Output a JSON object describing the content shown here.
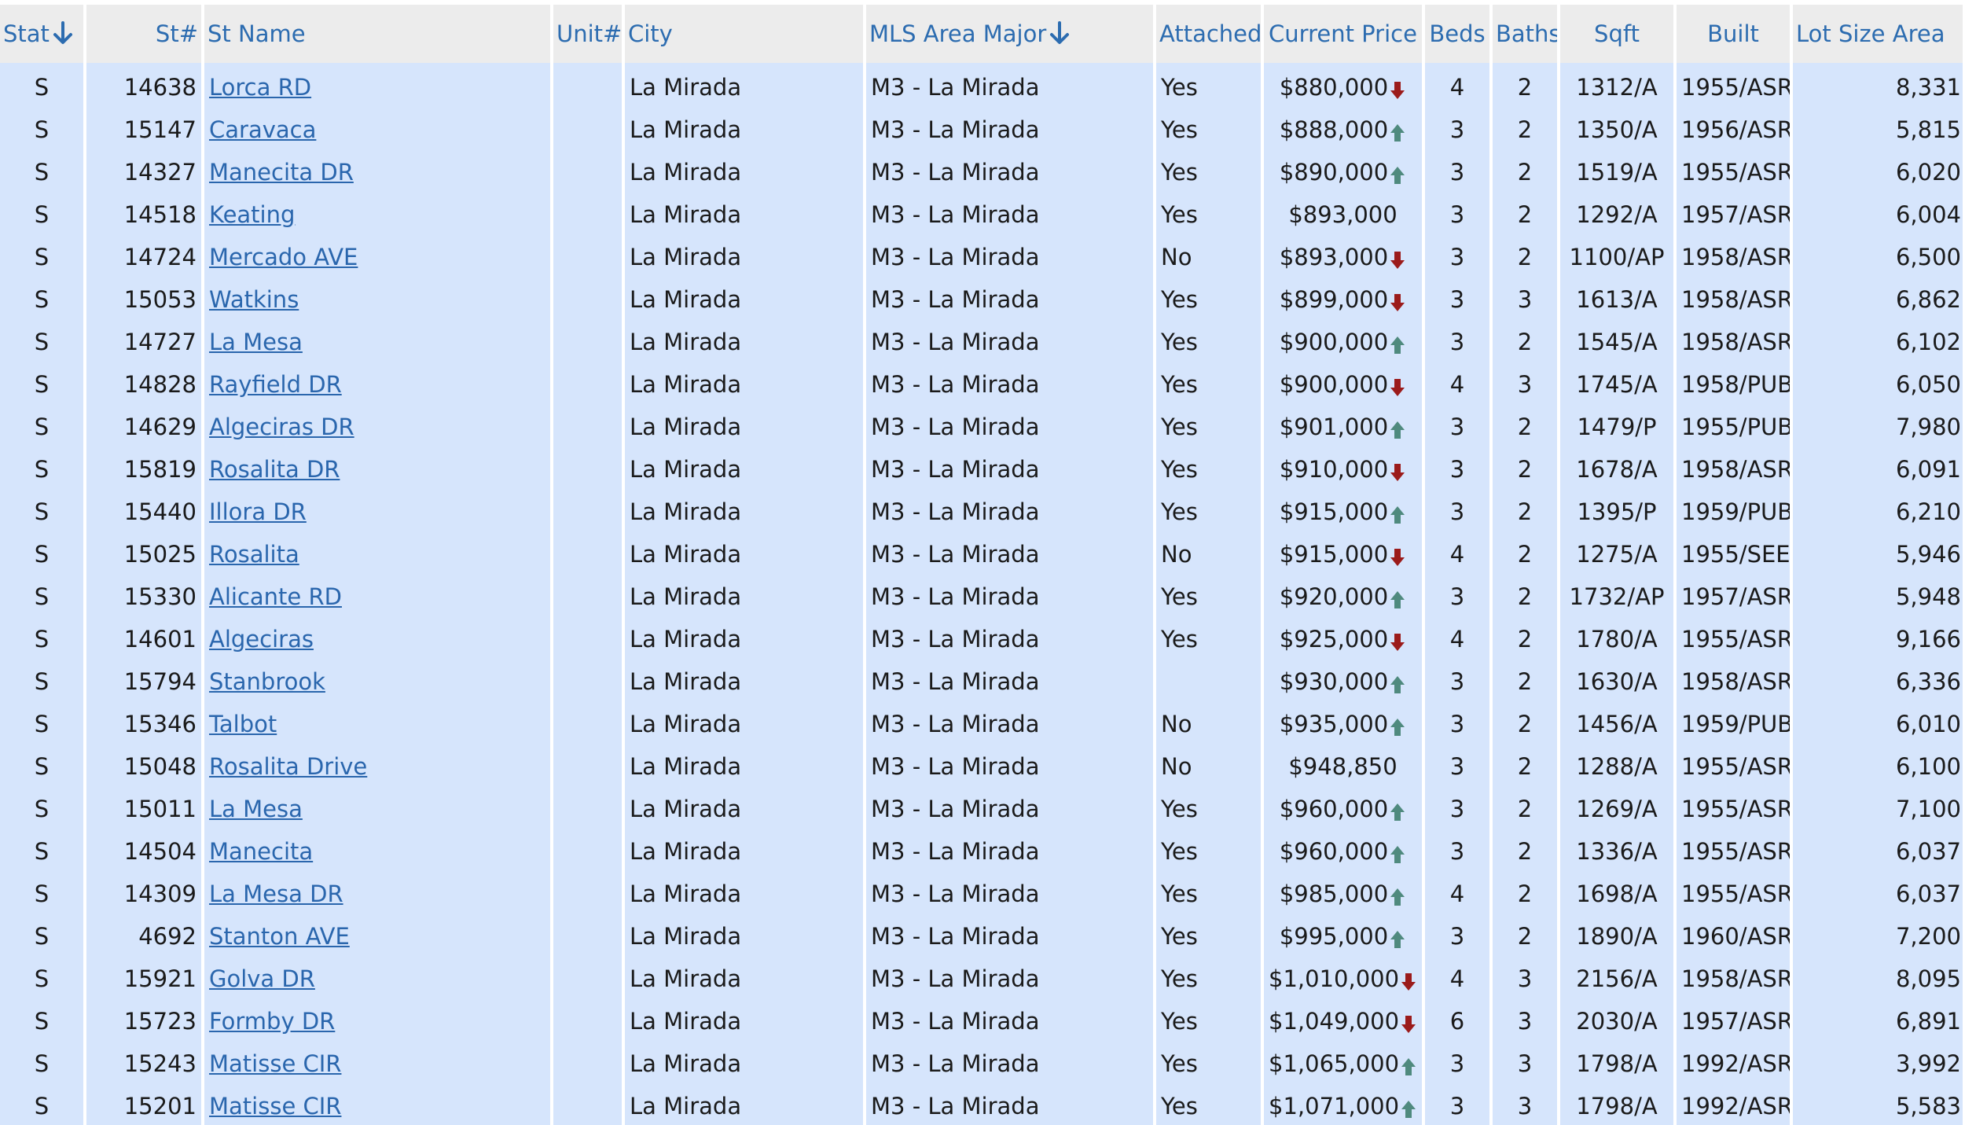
{
  "colors": {
    "header_bg": "#ececec",
    "header_text": "#2c6cb0",
    "row_bg": "#d6e5fc",
    "link": "#2a66ad",
    "trend_down": "#9b1b1b",
    "trend_up": "#4f8a7e"
  },
  "columns": [
    {
      "key": "stat",
      "label": "Stat",
      "sorted": true
    },
    {
      "key": "st_num",
      "label": "St#",
      "sorted": false
    },
    {
      "key": "st_name",
      "label": "St Name",
      "sorted": false
    },
    {
      "key": "unit",
      "label": "Unit#",
      "sorted": false
    },
    {
      "key": "city",
      "label": "City",
      "sorted": false
    },
    {
      "key": "mls_area",
      "label": "MLS Area Major",
      "sorted": true
    },
    {
      "key": "attached",
      "label": "Attached",
      "sorted": false
    },
    {
      "key": "price",
      "label": "Current Price",
      "sorted": false
    },
    {
      "key": "beds",
      "label": "Beds",
      "sorted": false
    },
    {
      "key": "baths",
      "label": "Baths",
      "sorted": false
    },
    {
      "key": "sqft",
      "label": "Sqft",
      "sorted": false
    },
    {
      "key": "built",
      "label": "Built",
      "sorted": false
    },
    {
      "key": "lot",
      "label": "Lot Size Area",
      "sorted": false
    }
  ],
  "rows": [
    {
      "stat": "S",
      "st_num": "14638",
      "st_name": "Lorca RD",
      "unit": "",
      "city": "La Mirada",
      "mls_area": "M3 - La Mirada",
      "attached": "Yes",
      "price": "$880,000",
      "trend": "down-arrow-icon",
      "beds": "4",
      "baths": "2",
      "sqft": "1312/A",
      "built": "1955/ASR",
      "lot": "8,331"
    },
    {
      "stat": "S",
      "st_num": "15147",
      "st_name": "Caravaca",
      "unit": "",
      "city": "La Mirada",
      "mls_area": "M3 - La Mirada",
      "attached": "Yes",
      "price": "$888,000",
      "trend": "up-arrow-icon",
      "beds": "3",
      "baths": "2",
      "sqft": "1350/A",
      "built": "1956/ASR",
      "lot": "5,815"
    },
    {
      "stat": "S",
      "st_num": "14327",
      "st_name": "Manecita DR",
      "unit": "",
      "city": "La Mirada",
      "mls_area": "M3 - La Mirada",
      "attached": "Yes",
      "price": "$890,000",
      "trend": "up-arrow-icon",
      "beds": "3",
      "baths": "2",
      "sqft": "1519/A",
      "built": "1955/ASR",
      "lot": "6,020"
    },
    {
      "stat": "S",
      "st_num": "14518",
      "st_name": "Keating",
      "unit": "",
      "city": "La Mirada",
      "mls_area": "M3 - La Mirada",
      "attached": "Yes",
      "price": "$893,000",
      "trend": "",
      "beds": "3",
      "baths": "2",
      "sqft": "1292/A",
      "built": "1957/ASR",
      "lot": "6,004"
    },
    {
      "stat": "S",
      "st_num": "14724",
      "st_name": "Mercado AVE",
      "unit": "",
      "city": "La Mirada",
      "mls_area": "M3 - La Mirada",
      "attached": "No",
      "price": "$893,000",
      "trend": "down-arrow-icon",
      "beds": "3",
      "baths": "2",
      "sqft": "1100/AP",
      "built": "1958/ASR",
      "lot": "6,500"
    },
    {
      "stat": "S",
      "st_num": "15053",
      "st_name": "Watkins",
      "unit": "",
      "city": "La Mirada",
      "mls_area": "M3 - La Mirada",
      "attached": "Yes",
      "price": "$899,000",
      "trend": "down-arrow-icon",
      "beds": "3",
      "baths": "3",
      "sqft": "1613/A",
      "built": "1958/ASR",
      "lot": "6,862"
    },
    {
      "stat": "S",
      "st_num": "14727",
      "st_name": "La Mesa",
      "unit": "",
      "city": "La Mirada",
      "mls_area": "M3 - La Mirada",
      "attached": "Yes",
      "price": "$900,000",
      "trend": "up-arrow-icon",
      "beds": "3",
      "baths": "2",
      "sqft": "1545/A",
      "built": "1958/ASR",
      "lot": "6,102"
    },
    {
      "stat": "S",
      "st_num": "14828",
      "st_name": "Rayfield DR",
      "unit": "",
      "city": "La Mirada",
      "mls_area": "M3 - La Mirada",
      "attached": "Yes",
      "price": "$900,000",
      "trend": "down-arrow-icon",
      "beds": "4",
      "baths": "3",
      "sqft": "1745/A",
      "built": "1958/PUB",
      "lot": "6,050"
    },
    {
      "stat": "S",
      "st_num": "14629",
      "st_name": "Algeciras DR",
      "unit": "",
      "city": "La Mirada",
      "mls_area": "M3 - La Mirada",
      "attached": "Yes",
      "price": "$901,000",
      "trend": "up-arrow-icon",
      "beds": "3",
      "baths": "2",
      "sqft": "1479/P",
      "built": "1955/PUB",
      "lot": "7,980"
    },
    {
      "stat": "S",
      "st_num": "15819",
      "st_name": "Rosalita DR",
      "unit": "",
      "city": "La Mirada",
      "mls_area": "M3 - La Mirada",
      "attached": "Yes",
      "price": "$910,000",
      "trend": "down-arrow-icon",
      "beds": "3",
      "baths": "2",
      "sqft": "1678/A",
      "built": "1958/ASR",
      "lot": "6,091"
    },
    {
      "stat": "S",
      "st_num": "15440",
      "st_name": "Illora DR",
      "unit": "",
      "city": "La Mirada",
      "mls_area": "M3 - La Mirada",
      "attached": "Yes",
      "price": "$915,000",
      "trend": "up-arrow-icon",
      "beds": "3",
      "baths": "2",
      "sqft": "1395/P",
      "built": "1959/PUB",
      "lot": "6,210"
    },
    {
      "stat": "S",
      "st_num": "15025",
      "st_name": "Rosalita",
      "unit": "",
      "city": "La Mirada",
      "mls_area": "M3 - La Mirada",
      "attached": "No",
      "price": "$915,000",
      "trend": "down-arrow-icon",
      "beds": "4",
      "baths": "2",
      "sqft": "1275/A",
      "built": "1955/SEE",
      "lot": "5,946"
    },
    {
      "stat": "S",
      "st_num": "15330",
      "st_name": "Alicante RD",
      "unit": "",
      "city": "La Mirada",
      "mls_area": "M3 - La Mirada",
      "attached": "Yes",
      "price": "$920,000",
      "trend": "up-arrow-icon",
      "beds": "3",
      "baths": "2",
      "sqft": "1732/AP",
      "built": "1957/ASR",
      "lot": "5,948"
    },
    {
      "stat": "S",
      "st_num": "14601",
      "st_name": "Algeciras",
      "unit": "",
      "city": "La Mirada",
      "mls_area": "M3 - La Mirada",
      "attached": "Yes",
      "price": "$925,000",
      "trend": "down-arrow-icon",
      "beds": "4",
      "baths": "2",
      "sqft": "1780/A",
      "built": "1955/ASR",
      "lot": "9,166"
    },
    {
      "stat": "S",
      "st_num": "15794",
      "st_name": "Stanbrook",
      "unit": "",
      "city": "La Mirada",
      "mls_area": "M3 - La Mirada",
      "attached": "",
      "price": "$930,000",
      "trend": "up-arrow-icon",
      "beds": "3",
      "baths": "2",
      "sqft": "1630/A",
      "built": "1958/ASR",
      "lot": "6,336"
    },
    {
      "stat": "S",
      "st_num": "15346",
      "st_name": "Talbot",
      "unit": "",
      "city": "La Mirada",
      "mls_area": "M3 - La Mirada",
      "attached": "No",
      "price": "$935,000",
      "trend": "up-arrow-icon",
      "beds": "3",
      "baths": "2",
      "sqft": "1456/A",
      "built": "1959/PUB",
      "lot": "6,010"
    },
    {
      "stat": "S",
      "st_num": "15048",
      "st_name": "Rosalita Drive",
      "unit": "",
      "city": "La Mirada",
      "mls_area": "M3 - La Mirada",
      "attached": "No",
      "price": "$948,850",
      "trend": "",
      "beds": "3",
      "baths": "2",
      "sqft": "1288/A",
      "built": "1955/ASR",
      "lot": "6,100"
    },
    {
      "stat": "S",
      "st_num": "15011",
      "st_name": "La Mesa",
      "unit": "",
      "city": "La Mirada",
      "mls_area": "M3 - La Mirada",
      "attached": "Yes",
      "price": "$960,000",
      "trend": "up-arrow-icon",
      "beds": "3",
      "baths": "2",
      "sqft": "1269/A",
      "built": "1955/ASR",
      "lot": "7,100"
    },
    {
      "stat": "S",
      "st_num": "14504",
      "st_name": "Manecita",
      "unit": "",
      "city": "La Mirada",
      "mls_area": "M3 - La Mirada",
      "attached": "Yes",
      "price": "$960,000",
      "trend": "up-arrow-icon",
      "beds": "3",
      "baths": "2",
      "sqft": "1336/A",
      "built": "1955/ASR",
      "lot": "6,037"
    },
    {
      "stat": "S",
      "st_num": "14309",
      "st_name": "La Mesa DR",
      "unit": "",
      "city": "La Mirada",
      "mls_area": "M3 - La Mirada",
      "attached": "Yes",
      "price": "$985,000",
      "trend": "up-arrow-icon",
      "beds": "4",
      "baths": "2",
      "sqft": "1698/A",
      "built": "1955/ASR",
      "lot": "6,037"
    },
    {
      "stat": "S",
      "st_num": "4692",
      "st_name": "Stanton AVE",
      "unit": "",
      "city": "La Mirada",
      "mls_area": "M3 - La Mirada",
      "attached": "Yes",
      "price": "$995,000",
      "trend": "up-arrow-icon",
      "beds": "3",
      "baths": "2",
      "sqft": "1890/A",
      "built": "1960/ASR",
      "lot": "7,200"
    },
    {
      "stat": "S",
      "st_num": "15921",
      "st_name": "Golva DR",
      "unit": "",
      "city": "La Mirada",
      "mls_area": "M3 - La Mirada",
      "attached": "Yes",
      "price": "$1,010,000",
      "trend": "down-arrow-icon",
      "beds": "4",
      "baths": "3",
      "sqft": "2156/A",
      "built": "1958/ASR",
      "lot": "8,095"
    },
    {
      "stat": "S",
      "st_num": "15723",
      "st_name": "Formby DR",
      "unit": "",
      "city": "La Mirada",
      "mls_area": "M3 - La Mirada",
      "attached": "Yes",
      "price": "$1,049,000",
      "trend": "down-arrow-icon",
      "beds": "6",
      "baths": "3",
      "sqft": "2030/A",
      "built": "1957/ASR",
      "lot": "6,891"
    },
    {
      "stat": "S",
      "st_num": "15243",
      "st_name": "Matisse CIR",
      "unit": "",
      "city": "La Mirada",
      "mls_area": "M3 - La Mirada",
      "attached": "Yes",
      "price": "$1,065,000",
      "trend": "up-arrow-icon",
      "beds": "3",
      "baths": "3",
      "sqft": "1798/A",
      "built": "1992/ASR",
      "lot": "3,992"
    },
    {
      "stat": "S",
      "st_num": "15201",
      "st_name": "Matisse CIR",
      "unit": "",
      "city": "La Mirada",
      "mls_area": "M3 - La Mirada",
      "attached": "Yes",
      "price": "$1,071,000",
      "trend": "up-arrow-icon",
      "beds": "3",
      "baths": "3",
      "sqft": "1798/A",
      "built": "1992/ASR",
      "lot": "5,583"
    }
  ]
}
